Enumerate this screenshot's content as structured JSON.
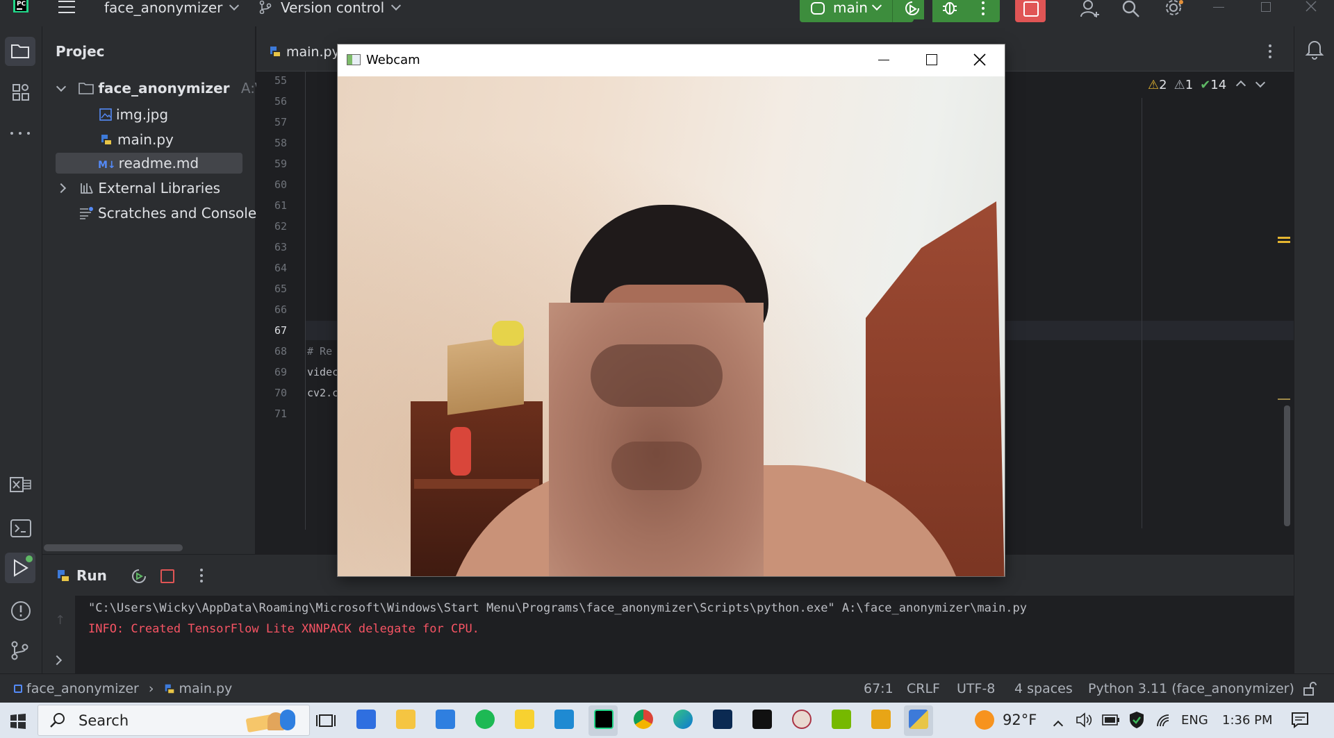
{
  "titlebar": {
    "project_name": "face_anonymizer",
    "vcs_label": "Version control",
    "run_config": "main"
  },
  "project_panel": {
    "title": "Projec",
    "root": {
      "label": "face_anonymizer",
      "path_hint": "A:\\fac"
    },
    "files": [
      {
        "label": "img.jpg"
      },
      {
        "label": "main.py"
      },
      {
        "label": "readme.md"
      }
    ],
    "external_libraries": "External Libraries",
    "scratches": "Scratches and Consoles"
  },
  "editor": {
    "active_tab": "main.py",
    "inspections": {
      "warnings": "2",
      "weak_warnings": "1",
      "typos": "14"
    },
    "line_numbers": [
      "55",
      "56",
      "57",
      "58",
      "59",
      "60",
      "61",
      "62",
      "63",
      "64",
      "65",
      "66",
      "67",
      "68",
      "69",
      "70",
      "71"
    ],
    "visible_code": {
      "l68": "# Re",
      "l69": "videc",
      "l70": "cv2.c"
    }
  },
  "webcam_window": {
    "title": "Webcam"
  },
  "run_panel": {
    "title": "Run",
    "command": "\"C:\\Users\\Wicky\\AppData\\Roaming\\Microsoft\\Windows\\Start Menu\\Programs\\face_anonymizer\\Scripts\\python.exe\" A:\\face_anonymizer\\main.py",
    "info_line": "INFO: Created TensorFlow Lite XNNPACK delegate for CPU."
  },
  "statusbar": {
    "breadcrumb_project": "face_anonymizer",
    "breadcrumb_file": "main.py",
    "position": "67:1",
    "line_ending": "CRLF",
    "encoding": "UTF-8",
    "indent": "4 spaces",
    "interpreter": "Python 3.11 (face_anonymizer)"
  },
  "taskbar": {
    "search_label": "Search",
    "weather": "92°F",
    "language": "ENG",
    "time": "1:36 PM"
  },
  "colors": {
    "run_green": "#3d8d3d",
    "stop_red": "#e05555",
    "error_text": "#f75464",
    "warning_yellow": "#e5b530"
  }
}
